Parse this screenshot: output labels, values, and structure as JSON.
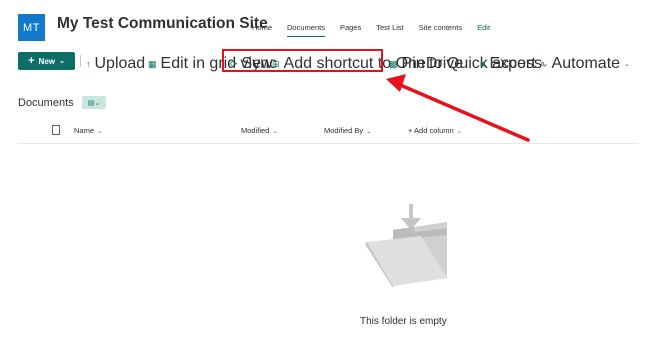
{
  "site": {
    "logo_initials": "MT",
    "title": "My Test Communication Site"
  },
  "nav": {
    "items": [
      "Home",
      "Documents",
      "Pages",
      "Test List",
      "Site contents"
    ],
    "active": "Documents",
    "edit_label": "Edit"
  },
  "commands": {
    "new_label": "New",
    "upload_label": "Upload",
    "grid_label": "Edit in grid view",
    "sync_label": "Sync",
    "shortcut_label": "Add shortcut to OneDrive",
    "pin_label": "Pin to Quick access",
    "export_label": "Export",
    "automate_label": "Automate"
  },
  "library": {
    "title": "Documents",
    "columns": {
      "name": "Name",
      "modified": "Modified",
      "modified_by": "Modified By",
      "add_column": "+ Add column"
    },
    "empty_message": "This folder is empty"
  },
  "colors": {
    "accent": "#0e6e65",
    "logo": "#1278c9",
    "annotation": "#e8101a"
  }
}
